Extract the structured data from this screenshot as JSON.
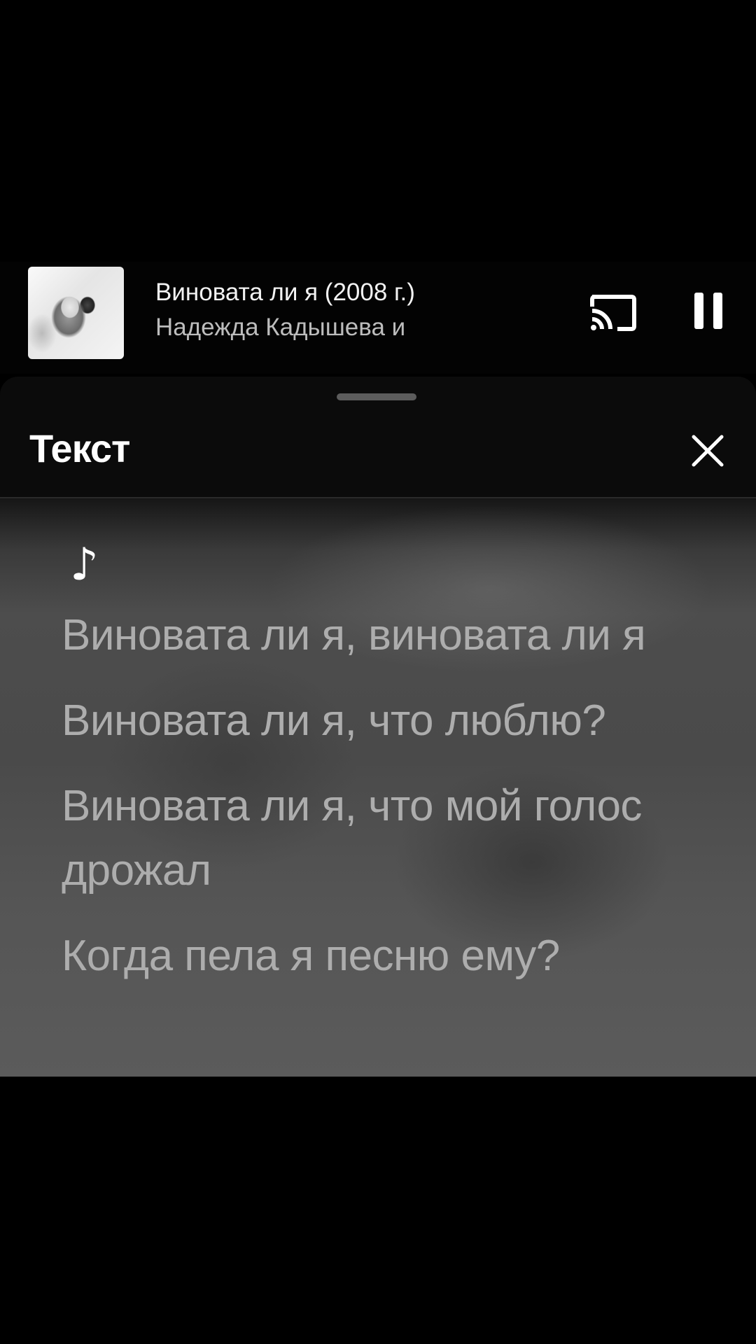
{
  "mini_player": {
    "title": "Виновата ли я (2008 г.)",
    "artist": "Надежда Кадышева и",
    "cast_icon": "cast-icon",
    "pause_icon": "pause-icon"
  },
  "lyrics_sheet": {
    "title": "Текст",
    "close_icon": "close-icon",
    "note_symbol": "♪",
    "lines": [
      "Виновата ли я, виновата ли я",
      "Виновата ли я, что люблю?",
      "Виновата ли я, что мой голос дрожал",
      "Когда пела я песню ему?"
    ]
  },
  "colors": {
    "background": "#000000",
    "sheet": "#0b0b0b",
    "lyric_text": "#adadad"
  }
}
